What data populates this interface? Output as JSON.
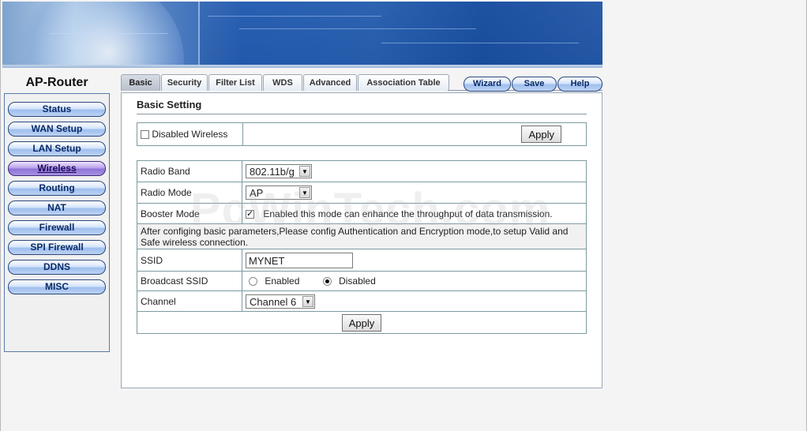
{
  "brand": "AP-Router",
  "sidebar": {
    "items": [
      {
        "label": "Status",
        "active": false
      },
      {
        "label": "WAN Setup",
        "active": false
      },
      {
        "label": "LAN Setup",
        "active": false
      },
      {
        "label": "Wireless",
        "active": true
      },
      {
        "label": "Routing",
        "active": false
      },
      {
        "label": "NAT",
        "active": false
      },
      {
        "label": "Firewall",
        "active": false
      },
      {
        "label": "SPI Firewall",
        "active": false
      },
      {
        "label": "DDNS",
        "active": false
      },
      {
        "label": "MISC",
        "active": false
      }
    ]
  },
  "tabs": [
    {
      "label": "Basic",
      "active": true
    },
    {
      "label": "Security",
      "active": false
    },
    {
      "label": "Filter List",
      "active": false
    },
    {
      "label": "WDS",
      "active": false
    },
    {
      "label": "Advanced",
      "active": false
    },
    {
      "label": "Association Table",
      "active": false
    }
  ],
  "top_buttons": {
    "wizard": "Wizard",
    "save": "Save",
    "help": "Help"
  },
  "section_title": "Basic Setting",
  "disable_wireless": {
    "label": "Disabled Wireless",
    "checked": false,
    "apply": "Apply"
  },
  "form": {
    "radio_band": {
      "label": "Radio Band",
      "value": "802.11b/g"
    },
    "radio_mode": {
      "label": "Radio Mode",
      "value": "AP"
    },
    "booster_mode": {
      "label": "Booster Mode",
      "checked": true,
      "text": "Enabled this mode can enhance the throughput of data transmission."
    },
    "note": "After configing basic parameters,Please config Authentication and Encryption mode,to setup Valid and Safe wireless connection.",
    "ssid": {
      "label": "SSID",
      "value": "MYNET"
    },
    "broadcast_ssid": {
      "label": "Broadcast SSID",
      "enabled": "Enabled",
      "disabled": "Disabled",
      "selected": "Disabled"
    },
    "channel": {
      "label": "Channel",
      "value": "Channel 6"
    },
    "apply": "Apply"
  },
  "watermark": "PcWinTech.com"
}
